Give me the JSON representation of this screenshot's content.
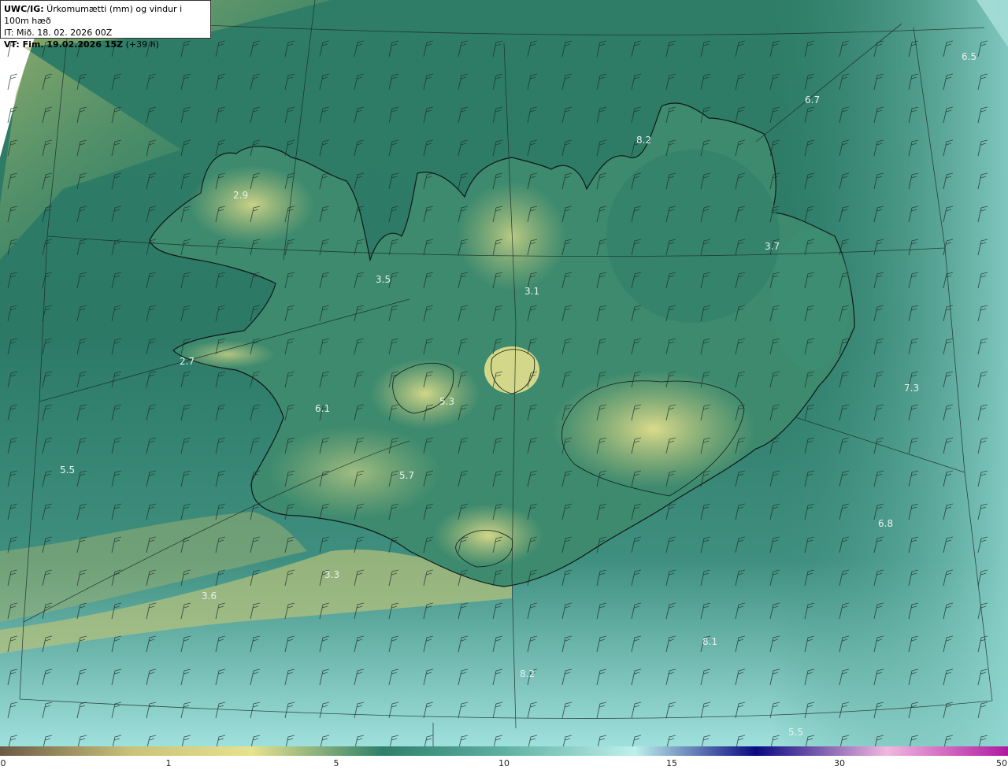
{
  "header": {
    "title_bold": "UWC/IG:",
    "title_text": " Úrkomumætti (mm) og vindur i 100m hæð",
    "init_time": "IT: Mið. 18. 02. 2026 00Z",
    "valid_bold": "VT: Fim. 19.02.2026 15Z",
    "valid_text": " (+39 h)"
  },
  "value_labels": [
    "2.9",
    "3.5",
    "3.1",
    "3.7",
    "8.2",
    "6.7",
    "6.5",
    "2.7",
    "6.1",
    "5.3",
    "5.7",
    "5.5",
    "7.3",
    "6.8",
    "3.3",
    "3.6",
    "8.1",
    "8.2",
    "5.5"
  ],
  "colorbar": {
    "ticks": [
      "0",
      "1",
      "5",
      "10",
      "15",
      "30",
      "50"
    ],
    "colors": [
      "#6b5a45",
      "#c9c27a",
      "#e6e28e",
      "#2f7f6a",
      "#5fb0a4",
      "#bdf0ec",
      "#0a0a80",
      "#f2b6e0",
      "#b01aa0"
    ]
  }
}
